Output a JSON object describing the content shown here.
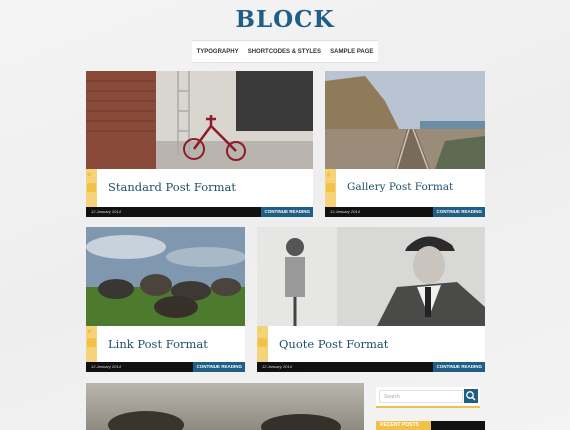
{
  "site": {
    "title": "BLOCK"
  },
  "nav": {
    "items": [
      "TYPOGRAPHY",
      "SHORTCODES & STYLES",
      "SAMPLE PAGE"
    ]
  },
  "posts": [
    {
      "title": "Standard Post Format",
      "date": "12 January 2014",
      "cta": "CONTINUE READING",
      "icon": "speech-bubble-icon"
    },
    {
      "title": "Gallery Post Format",
      "date": "12 January 2014",
      "cta": "CONTINUE READING",
      "icon": "gallery-icon"
    },
    {
      "title": "Link Post Format",
      "date": "12 January 2014",
      "cta": "CONTINUE READING",
      "icon": "link-icon"
    },
    {
      "title": "Quote Post Format",
      "date": "12 January 2014",
      "cta": "CONTINUE READING",
      "icon": "quote-icon"
    }
  ],
  "sidebar": {
    "search_placeholder": "Search",
    "recent_posts_label": "RECENT POSTS"
  },
  "colors": {
    "brand": "#1f5f86",
    "accent": "#f1c14a",
    "bar": "#111111"
  }
}
